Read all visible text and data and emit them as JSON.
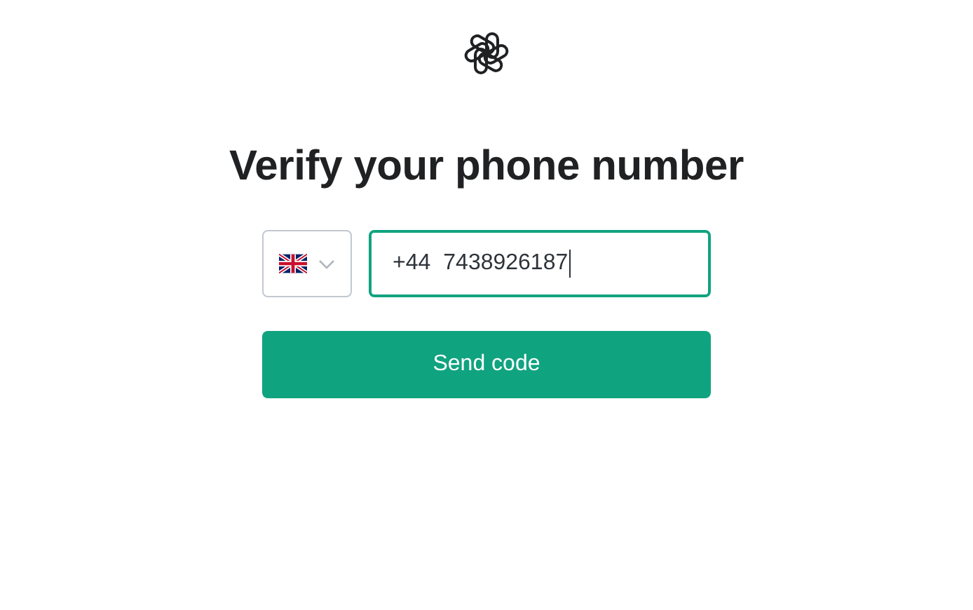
{
  "title": "Verify your phone number",
  "phone": {
    "country_code": "+44",
    "value": "7438926187",
    "focused": true
  },
  "button": "Send code"
}
